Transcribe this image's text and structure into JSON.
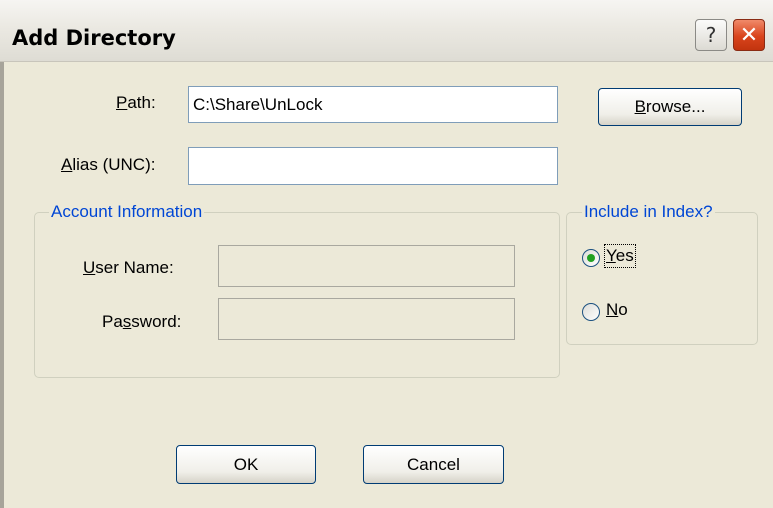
{
  "window": {
    "title": "Add Directory",
    "help_glyph": "?",
    "close_glyph": "✕"
  },
  "form": {
    "path": {
      "label_pre": "",
      "label_accel": "P",
      "label_post": "ath:",
      "value": "C:\\Share\\UnLock"
    },
    "alias": {
      "label_pre": "",
      "label_accel": "A",
      "label_post": "lias (UNC):",
      "value": ""
    },
    "browse_button": {
      "pre": "",
      "accel": "B",
      "post": "rowse..."
    }
  },
  "account_group": {
    "legend": "Account Information",
    "user_name": {
      "label_pre": "",
      "label_accel": "U",
      "label_post": "ser Name:",
      "value": ""
    },
    "password": {
      "label_pre": "Pa",
      "label_accel": "s",
      "label_post": "sword:",
      "value": ""
    }
  },
  "index_group": {
    "legend": "Include in Index?",
    "options": [
      {
        "pre": "",
        "accel": "Y",
        "post": "es",
        "selected": true
      },
      {
        "pre": "",
        "accel": "N",
        "post": "o",
        "selected": false
      }
    ]
  },
  "buttons": {
    "ok": "OK",
    "cancel": "Cancel"
  },
  "icons": {
    "help": "help-icon",
    "close": "close-icon",
    "radio_selected": "radio-selected-icon",
    "radio_unselected": "radio-unselected-icon"
  },
  "colors": {
    "dialog_bg": "#ece9d8",
    "group_legend": "#0046d5",
    "close_button": "#d9441c",
    "radio_dot": "#21a121"
  }
}
